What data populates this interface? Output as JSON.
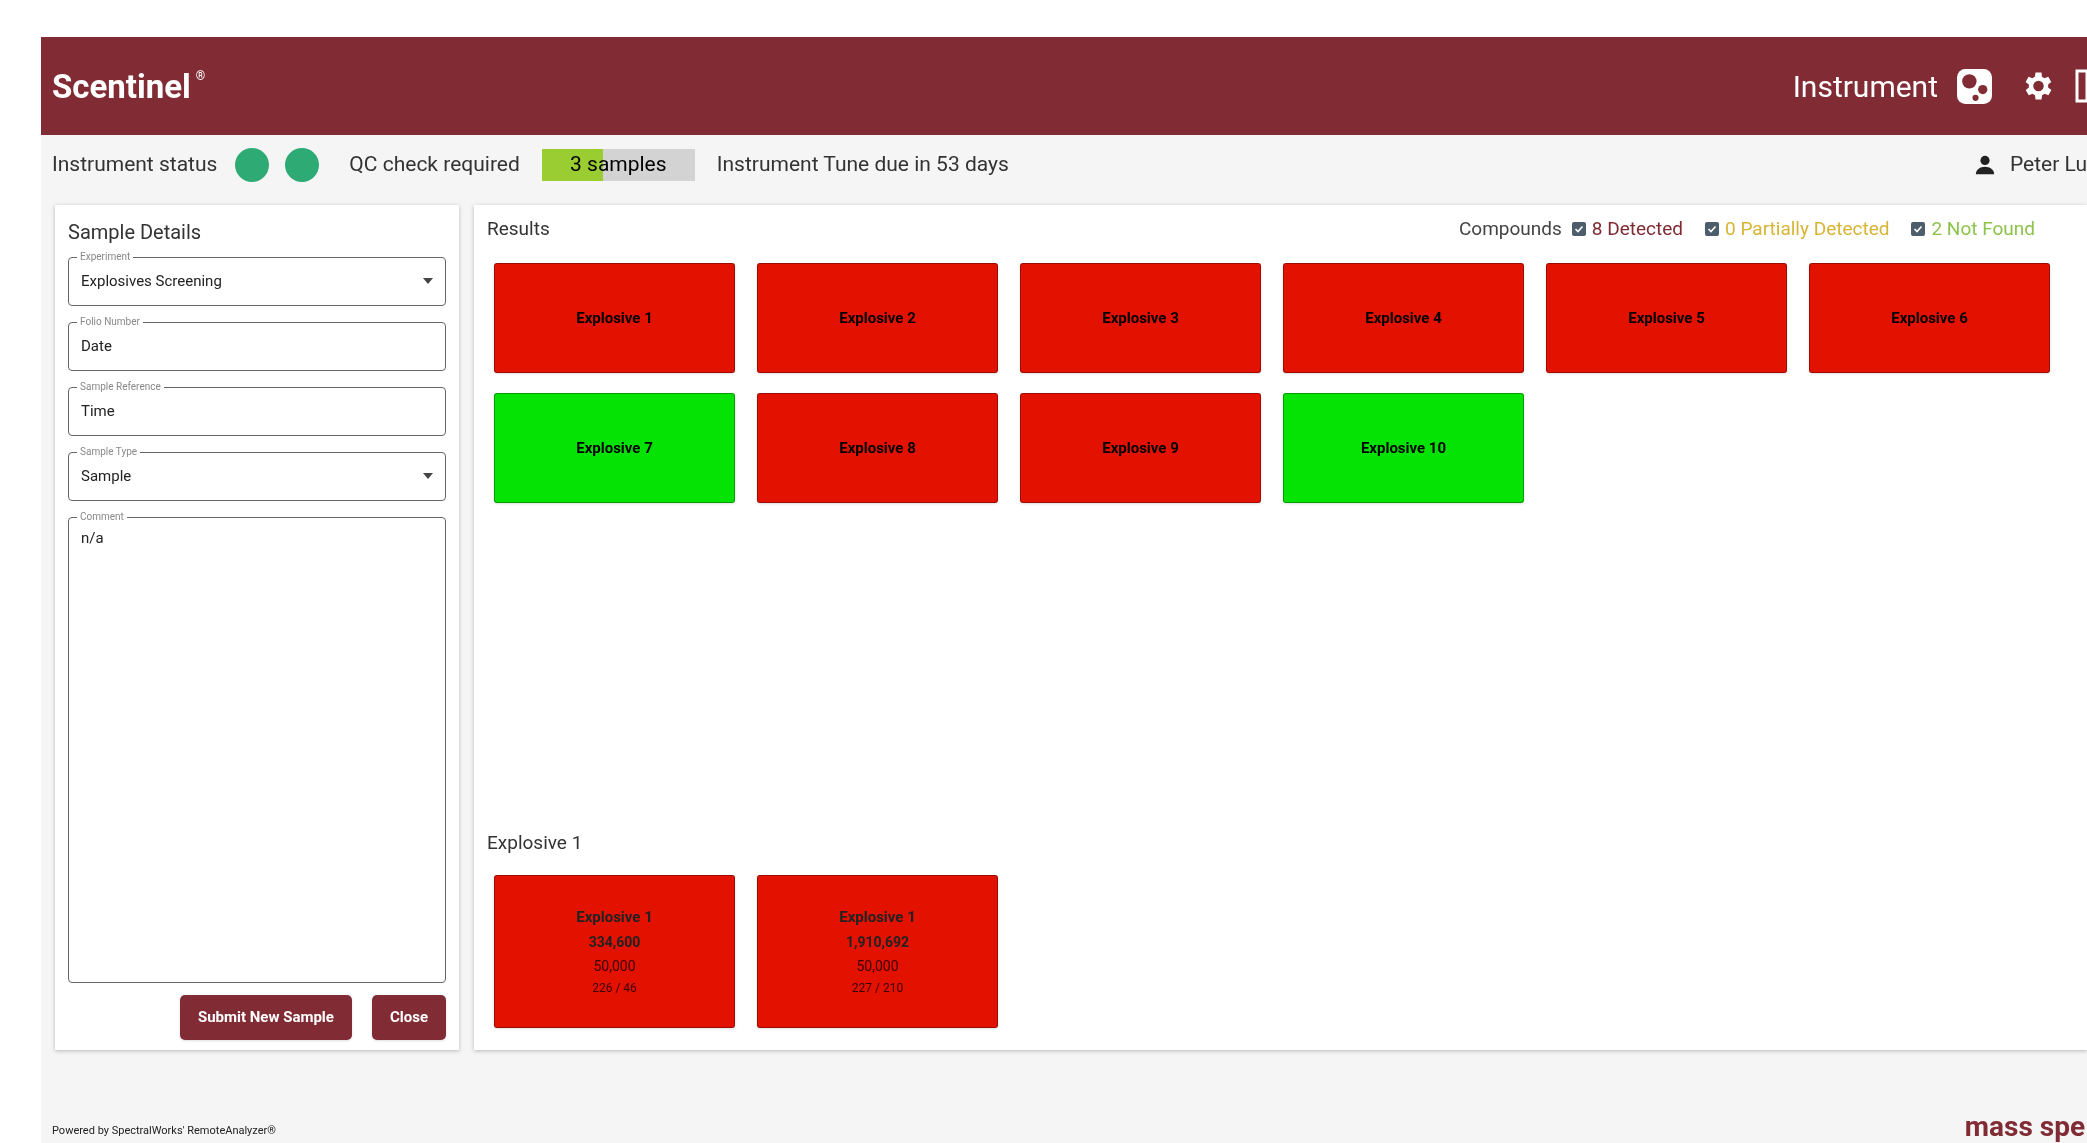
{
  "app": {
    "title": "Scentinel",
    "title_mark": "®",
    "instrument_label": "Instrument"
  },
  "status_bar": {
    "instrument_status_label": "Instrument status",
    "status_lights": [
      {
        "color": "#2eaa74"
      },
      {
        "color": "#2eaa74"
      }
    ],
    "qc_label": "QC check required",
    "qc_progress": {
      "text": "3 samples",
      "level": 0.4
    },
    "tune_text": "Instrument Tune due in 53 days",
    "user": "Peter Lu"
  },
  "sample_details": {
    "title": "Sample Details",
    "fields": [
      {
        "kind": "select",
        "label": "Experiment",
        "value": "Explosives Screening"
      },
      {
        "kind": "text",
        "label": "Folio Number",
        "value": "Date"
      },
      {
        "kind": "text",
        "label": "Sample Reference",
        "value": "Time"
      },
      {
        "kind": "select",
        "label": "Sample Type",
        "value": "Sample"
      },
      {
        "kind": "textarea",
        "label": "Comment",
        "value": "n/a"
      }
    ],
    "buttons": [
      "Submit New Sample",
      "Close"
    ]
  },
  "results": {
    "title": "Results",
    "legend_label": "Compounds",
    "legend": [
      {
        "text": "8 Detected",
        "checked": true,
        "color": "#7f2a33"
      },
      {
        "text": "0 Partially Detected",
        "checked": true,
        "color": "#d8b435"
      },
      {
        "text": "2 Not Found",
        "checked": true,
        "color": "#8cc34a"
      }
    ],
    "compounds": [
      {
        "name": "Explosive 1",
        "color": "#e31100"
      },
      {
        "name": "Explosive 2",
        "color": "#e31100"
      },
      {
        "name": "Explosive 3",
        "color": "#e31100"
      },
      {
        "name": "Explosive 4",
        "color": "#e31100"
      },
      {
        "name": "Explosive 5",
        "color": "#e31100"
      },
      {
        "name": "Explosive 6",
        "color": "#e31100"
      },
      {
        "name": "Explosive 7",
        "color": "#05e305"
      },
      {
        "name": "Explosive 8",
        "color": "#e31100"
      },
      {
        "name": "Explosive 9",
        "color": "#e31100"
      },
      {
        "name": "Explosive 10",
        "color": "#05e305"
      }
    ],
    "detail_title": "Explosive 1",
    "detail_tiles": [
      {
        "name": "Explosive 1",
        "color": "#e31100",
        "value": "334,600",
        "threshold": "50,000",
        "ratio": "226 / 46"
      },
      {
        "name": "Explosive 1",
        "color": "#e31100",
        "value": "1,910,692",
        "threshold": "50,000",
        "ratio": "227 / 210"
      }
    ]
  },
  "footer": {
    "text": "Powered by SpectralWorks' RemoteAnalyzer®",
    "logo_text": "mass spe"
  }
}
